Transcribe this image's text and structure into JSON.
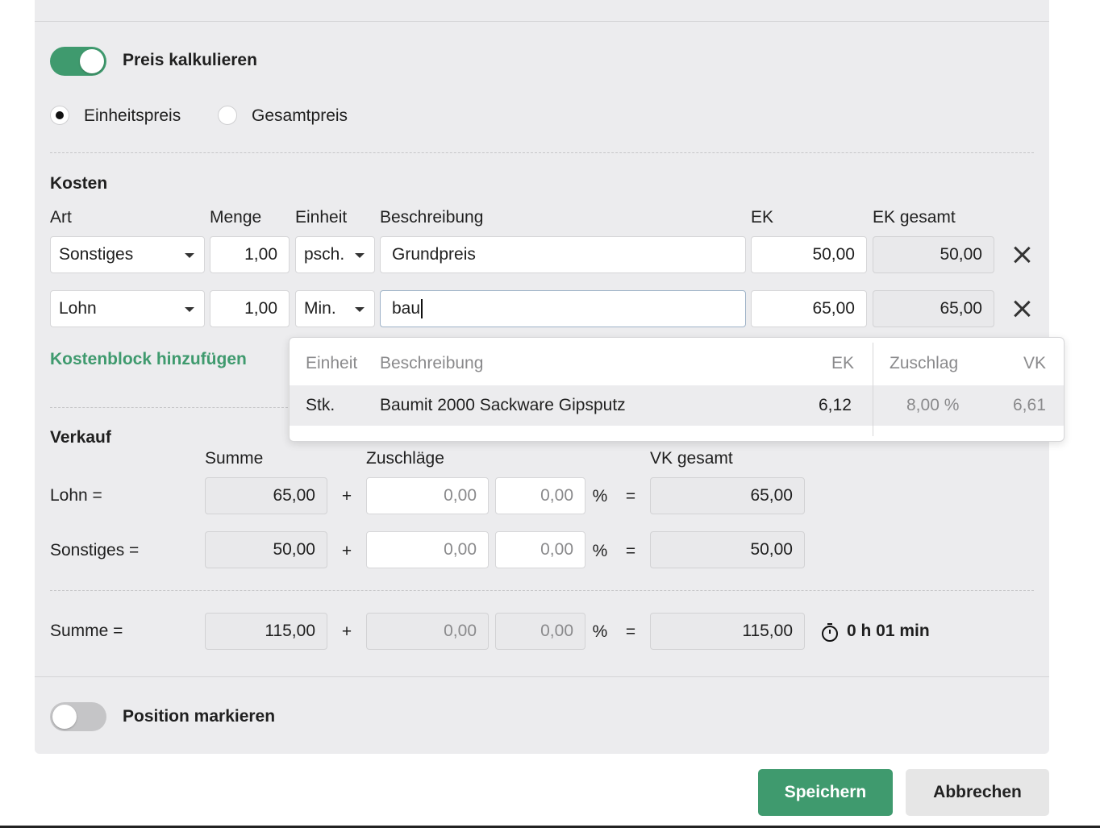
{
  "preis": {
    "toggle_label": "Preis kalkulieren",
    "toggle_on": true
  },
  "price_mode": {
    "options": [
      "Einheitspreis",
      "Gesamtpreis"
    ],
    "selected": "Einheitspreis"
  },
  "kosten": {
    "title": "Kosten",
    "headers": {
      "art": "Art",
      "menge": "Menge",
      "einheit": "Einheit",
      "beschreibung": "Beschreibung",
      "ek": "EK",
      "ek_gesamt": "EK gesamt"
    },
    "rows": [
      {
        "art": "Sonstiges",
        "menge": "1,00",
        "einheit": "psch.",
        "beschreibung": "Grundpreis",
        "ek": "50,00",
        "ek_gesamt": "50,00"
      },
      {
        "art": "Lohn",
        "menge": "1,00",
        "einheit": "Min.",
        "beschreibung": "bau",
        "ek": "65,00",
        "ek_gesamt": "65,00"
      }
    ],
    "add_link": "Kostenblock hinzufügen"
  },
  "suggestions": {
    "headers": {
      "einheit": "Einheit",
      "beschreibung": "Beschreibung",
      "ek": "EK",
      "zuschlag": "Zuschlag",
      "vk": "VK"
    },
    "items": [
      {
        "einheit": "Stk.",
        "beschreibung": "Baumit 2000 Sackware Gipsputz",
        "ek": "6,12",
        "zuschlag": "8,00 %",
        "vk": "6,61"
      }
    ]
  },
  "verkauf": {
    "title": "Verkauf",
    "headers": {
      "summe": "Summe",
      "zuschlaege": "Zuschläge",
      "vk_gesamt": "VK gesamt"
    },
    "rows": [
      {
        "label": "Lohn =",
        "summe": "65,00",
        "zuschlag_abs": "0,00",
        "zuschlag_pct": "0,00",
        "vk_gesamt": "65,00"
      },
      {
        "label": "Sonstiges =",
        "summe": "50,00",
        "zuschlag_abs": "0,00",
        "zuschlag_pct": "0,00",
        "vk_gesamt": "50,00"
      }
    ],
    "total": {
      "label": "Summe =",
      "summe": "115,00",
      "zuschlag_abs": "0,00",
      "zuschlag_pct": "0,00",
      "vk_gesamt": "115,00",
      "time": "0 h 01 min"
    },
    "ops": {
      "plus": "+",
      "percent": "%",
      "equals": "="
    }
  },
  "position": {
    "toggle_label": "Position markieren",
    "toggle_on": false
  },
  "actions": {
    "save": "Speichern",
    "cancel": "Abbrechen"
  },
  "colors": {
    "accent": "#3f9a6e",
    "panel": "#ececee"
  }
}
